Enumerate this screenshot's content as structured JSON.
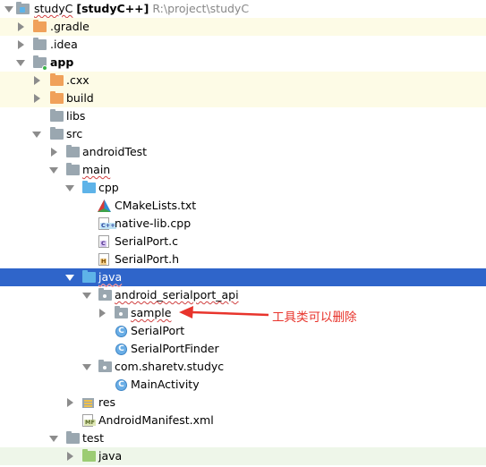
{
  "tree": {
    "root": {
      "name": "studyC",
      "module": "[studyC++]",
      "path": "R:\\project\\studyC"
    },
    "gradle": ".gradle",
    "idea": ".idea",
    "app": "app",
    "cxx": ".cxx",
    "build": "build",
    "libs": "libs",
    "src": "src",
    "androidTest": "androidTest",
    "main": "main",
    "cpp": "cpp",
    "cmake": "CMakeLists.txt",
    "nativeLib": "native-lib.cpp",
    "serialPortC": "SerialPort.c",
    "serialPortH": "SerialPort.h",
    "java": "java",
    "androidSerialportApi": "android_serialport_api",
    "sample": "sample",
    "serialPort": "SerialPort",
    "serialPortFinder": "SerialPortFinder",
    "comSharetv": "com.sharetv.studyc",
    "mainActivity": "MainActivity",
    "res": "res",
    "manifest": "AndroidManifest.xml",
    "test": "test",
    "testJava": "java"
  },
  "icons": {
    "class_letter": "C",
    "tag_cpp": "C++",
    "tag_c": "C",
    "tag_h": "H",
    "tag_mf": "MF"
  },
  "annotation": {
    "text": "工具类可以删除",
    "color": "#e8342c"
  },
  "colors": {
    "selection": "#2f65ca",
    "folder_orange": "#f0a15a",
    "folder_blue": "#5eb3e8",
    "folder_green": "#9ccc73"
  }
}
